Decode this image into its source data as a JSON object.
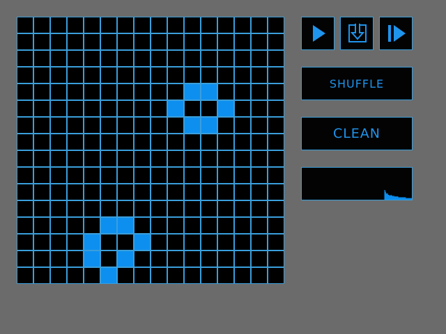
{
  "colors": {
    "background": "#6b6b6b",
    "grid_line": "#3a9fdc",
    "cell_dead": "#000000",
    "cell_alive": "#0d8fef",
    "button_text": "#1f94ec"
  },
  "board": {
    "rows": 16,
    "cols": 16,
    "alive_cells": [
      [
        4,
        10
      ],
      [
        4,
        11
      ],
      [
        5,
        9
      ],
      [
        5,
        12
      ],
      [
        6,
        10
      ],
      [
        6,
        11
      ],
      [
        12,
        5
      ],
      [
        12,
        6
      ],
      [
        13,
        4
      ],
      [
        13,
        7
      ],
      [
        14,
        4
      ],
      [
        14,
        6
      ],
      [
        15,
        5
      ]
    ]
  },
  "controls": {
    "play_icon": "play-icon",
    "step_icon": "step-down-icon",
    "next_icon": "next-frame-icon",
    "shuffle_label": "SHUFFLE",
    "clean_label": "CLEAN"
  },
  "population_history": [
    0,
    0,
    0,
    0,
    0,
    0,
    0,
    0,
    0,
    0,
    0,
    0,
    0,
    0,
    0,
    0,
    0,
    0,
    0,
    0,
    0,
    0,
    0,
    0,
    0,
    0,
    0,
    0,
    0,
    0,
    0,
    0,
    0,
    0,
    0,
    0,
    0,
    0,
    0,
    0,
    0,
    0,
    0,
    0,
    0,
    0,
    0,
    0,
    0,
    0,
    0,
    0,
    0,
    0,
    0,
    0,
    0,
    0,
    0,
    0,
    0,
    0,
    0,
    0,
    0,
    0,
    0,
    0,
    0,
    0,
    0,
    0,
    0,
    0,
    0,
    0,
    0,
    0,
    0,
    0,
    0,
    0,
    0,
    0,
    0,
    0,
    0,
    0,
    0,
    0,
    0,
    0,
    0,
    0,
    0,
    0,
    0,
    0,
    0,
    0,
    0,
    0,
    0,
    0,
    0,
    0,
    0,
    0,
    0,
    0,
    0,
    0,
    0,
    0,
    0,
    0,
    0,
    0,
    0,
    0,
    12,
    10,
    8,
    7,
    8,
    6,
    6,
    5,
    5,
    6,
    5,
    5,
    4,
    5,
    4,
    4,
    4,
    4,
    4,
    4,
    3,
    3,
    3,
    3,
    3,
    3,
    3,
    3,
    3,
    3,
    3,
    2,
    2,
    2,
    2,
    2,
    2,
    2,
    2,
    2
  ]
}
